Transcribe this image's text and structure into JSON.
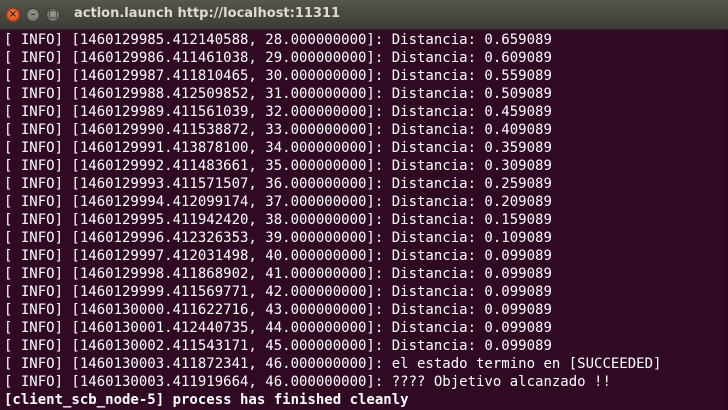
{
  "window": {
    "title": "action.launch http://localhost:11311",
    "close_glyph": "×",
    "minimize_glyph": "–",
    "maximize_glyph": "□"
  },
  "colors": {
    "terminal_background": "#300a24",
    "terminal_text": "#ffffff",
    "titlebar": "#3c3b37",
    "close_button": "#e2571f"
  },
  "terminal": {
    "lines": [
      "[ INFO] [1460129985.412140588, 28.000000000]: Distancia: 0.659089",
      "[ INFO] [1460129986.411461038, 29.000000000]: Distancia: 0.609089",
      "[ INFO] [1460129987.411810465, 30.000000000]: Distancia: 0.559089",
      "[ INFO] [1460129988.412509852, 31.000000000]: Distancia: 0.509089",
      "[ INFO] [1460129989.411561039, 32.000000000]: Distancia: 0.459089",
      "[ INFO] [1460129990.411538872, 33.000000000]: Distancia: 0.409089",
      "[ INFO] [1460129991.413878100, 34.000000000]: Distancia: 0.359089",
      "[ INFO] [1460129992.411483661, 35.000000000]: Distancia: 0.309089",
      "[ INFO] [1460129993.411571507, 36.000000000]: Distancia: 0.259089",
      "[ INFO] [1460129994.412099174, 37.000000000]: Distancia: 0.209089",
      "[ INFO] [1460129995.411942420, 38.000000000]: Distancia: 0.159089",
      "[ INFO] [1460129996.412326353, 39.000000000]: Distancia: 0.109089",
      "[ INFO] [1460129997.412031498, 40.000000000]: Distancia: 0.099089",
      "[ INFO] [1460129998.411868902, 41.000000000]: Distancia: 0.099089",
      "[ INFO] [1460129999.411569771, 42.000000000]: Distancia: 0.099089",
      "[ INFO] [1460130000.411622716, 43.000000000]: Distancia: 0.099089",
      "[ INFO] [1460130001.412440735, 44.000000000]: Distancia: 0.099089",
      "[ INFO] [1460130002.411543171, 45.000000000]: Distancia: 0.099089",
      "[ INFO] [1460130003.411872341, 46.000000000]: el estado termino en [SUCCEEDED]",
      "[ INFO] [1460130003.411919664, 46.000000000]: ???? Objetivo alcanzado !!"
    ],
    "final_line": "[client_scb_node-5] process has finished cleanly"
  }
}
